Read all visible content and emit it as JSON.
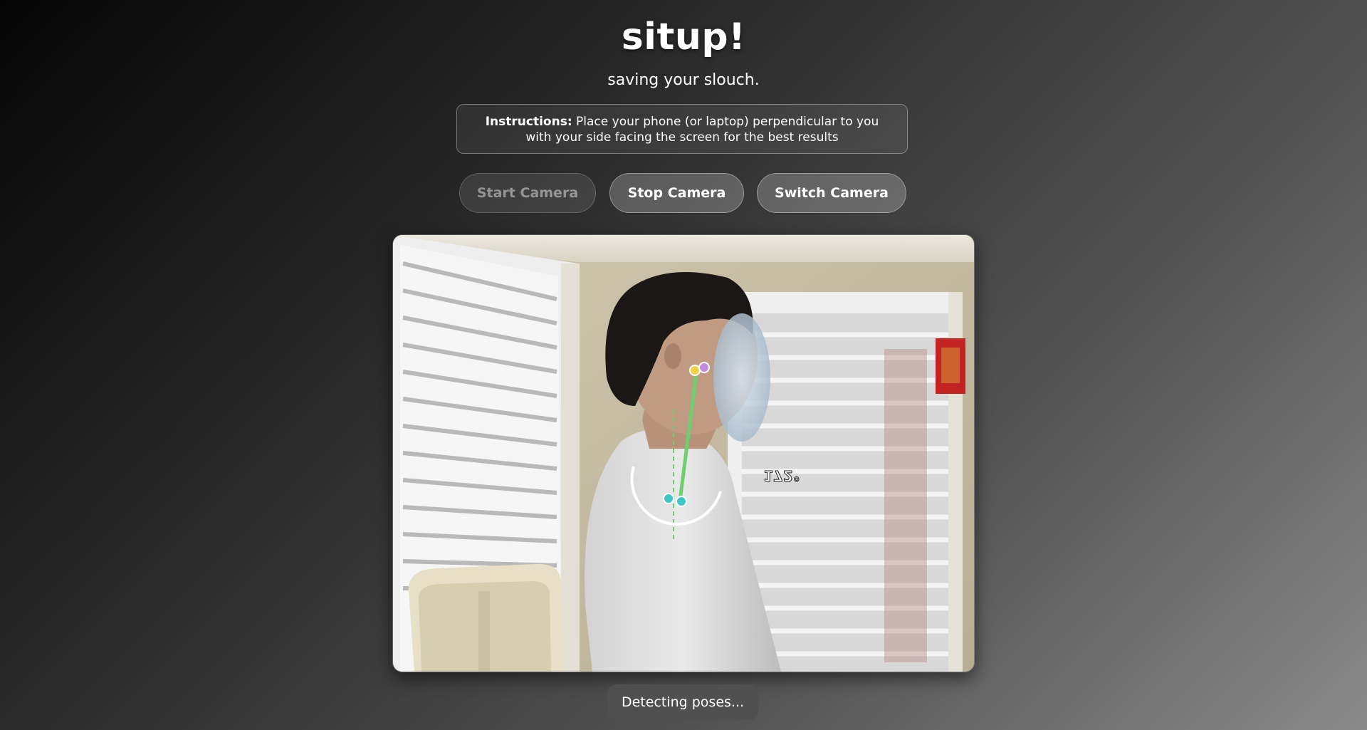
{
  "app": {
    "title": "situp!",
    "subtitle": "saving your slouch."
  },
  "instructions": {
    "lead": "Instructions:",
    "text": " Place your phone (or laptop) perpendicular to you with your side facing the screen for the best results"
  },
  "buttons": {
    "start": "Start Camera",
    "stop": "Stop Camera",
    "switch": "Switch Camera",
    "start_disabled": true
  },
  "pose_overlay": {
    "angle_label": "172°",
    "colors": {
      "neck_line": "#6fcf6f",
      "ear_point_left": "#f2d24b",
      "ear_point_right": "#c58ad9",
      "shoulder_points": "#3fc6c6",
      "arc": "#ffffff"
    }
  },
  "status": {
    "text": "Detecting poses..."
  }
}
